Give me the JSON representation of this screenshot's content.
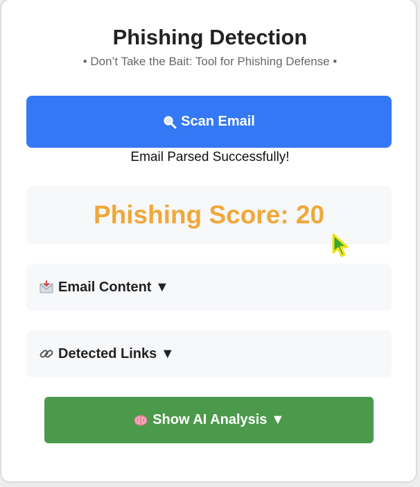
{
  "header": {
    "title": "Phishing Detection",
    "subtitle": "• Don’t Take the Bait: Tool for Phishing Defense •"
  },
  "scan": {
    "icon": "magnifier-icon",
    "label": "Scan Email",
    "color": "#3478f6"
  },
  "status": {
    "message": "Email Parsed Successfully!"
  },
  "score": {
    "label": "Phishing Score: 20",
    "value": 20,
    "color": "#f0a83a"
  },
  "sections": {
    "email_content": {
      "icon": "envelope-icon",
      "label": "Email Content ▼"
    },
    "detected_links": {
      "icon": "link-icon",
      "label": "Detected Links ▼"
    }
  },
  "ai": {
    "icon": "brain-icon",
    "label": "Show AI Analysis ▼",
    "color": "#4b9a4b"
  }
}
